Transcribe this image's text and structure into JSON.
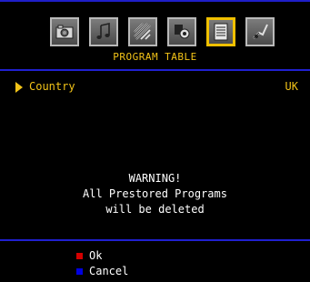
{
  "menu": {
    "title": "PROGRAM TABLE",
    "icons": [
      {
        "name": "picture-menu-icon",
        "active": false
      },
      {
        "name": "sound-menu-icon",
        "active": false
      },
      {
        "name": "feature-menu-icon",
        "active": false
      },
      {
        "name": "install-menu-icon",
        "active": false
      },
      {
        "name": "program-table-icon",
        "active": true
      },
      {
        "name": "source-menu-icon",
        "active": false
      }
    ]
  },
  "setting": {
    "label": "Country",
    "value": "UK"
  },
  "warning": {
    "heading": "WARNING!",
    "line1": "All Prestored Programs",
    "line2": "will be deleted"
  },
  "actions": {
    "ok": {
      "label": "Ok",
      "color": "#d40000"
    },
    "cancel": {
      "label": "Cancel",
      "color": "#0000e0"
    }
  },
  "colors": {
    "accent": "#f2c318",
    "rule": "#2020d0"
  }
}
